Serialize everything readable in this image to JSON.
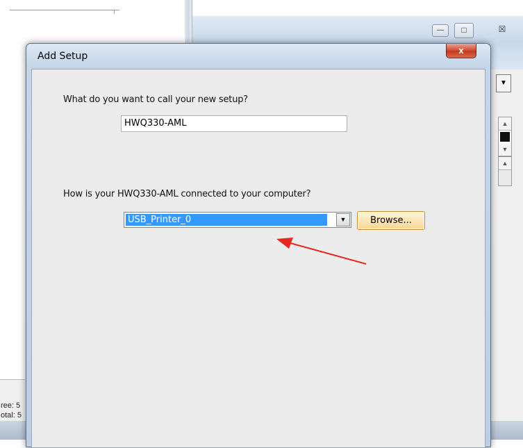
{
  "background": {
    "status_line1": "ree: 5",
    "status_line2": "otal: 5",
    "restore_icon": "□",
    "close_icon": "☒"
  },
  "dialog": {
    "title": "Add Setup",
    "close_glyph": "x",
    "question_name": "What do you want to call your new setup?",
    "setup_name_value": "HWQ330-AML",
    "question_connection": "How is your HWQ330-AML connected to your computer?",
    "connection_value": "USB_Printer_0",
    "browse_label": "Browse..."
  },
  "annotation": {
    "arrow_color": "#e8281e"
  }
}
